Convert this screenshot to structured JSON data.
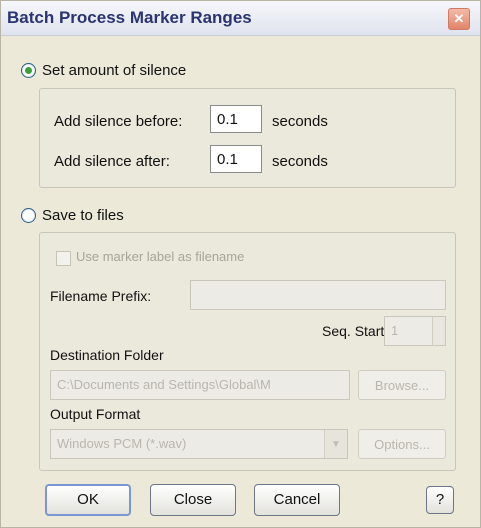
{
  "window": {
    "title": "Batch Process Marker Ranges",
    "close_glyph": "✕"
  },
  "silence": {
    "radio_label": "Set amount of silence",
    "selected": true,
    "before_label": "Add silence before:",
    "before_value": "0.1",
    "before_unit": "seconds",
    "after_label": "Add silence after:",
    "after_value": "0.1",
    "after_unit": "seconds"
  },
  "save": {
    "radio_label": "Save to files",
    "selected": false,
    "use_marker_label": "Use marker label as filename",
    "filename_prefix_label": "Filename Prefix:",
    "filename_prefix_value": "",
    "seq_start_label": "Seq. Start",
    "seq_start_value": "1",
    "destination_label": "Destination Folder",
    "destination_value": "C:\\Documents and Settings\\Global\\M",
    "browse_label": "Browse...",
    "output_format_label": "Output Format",
    "output_format_value": "Windows PCM (*.wav)",
    "options_label": "Options..."
  },
  "buttons": {
    "ok": "OK",
    "close": "Close",
    "cancel": "Cancel",
    "help": "?"
  },
  "icons": {
    "close": "close-icon",
    "dropdown": "chevron-down-icon"
  }
}
